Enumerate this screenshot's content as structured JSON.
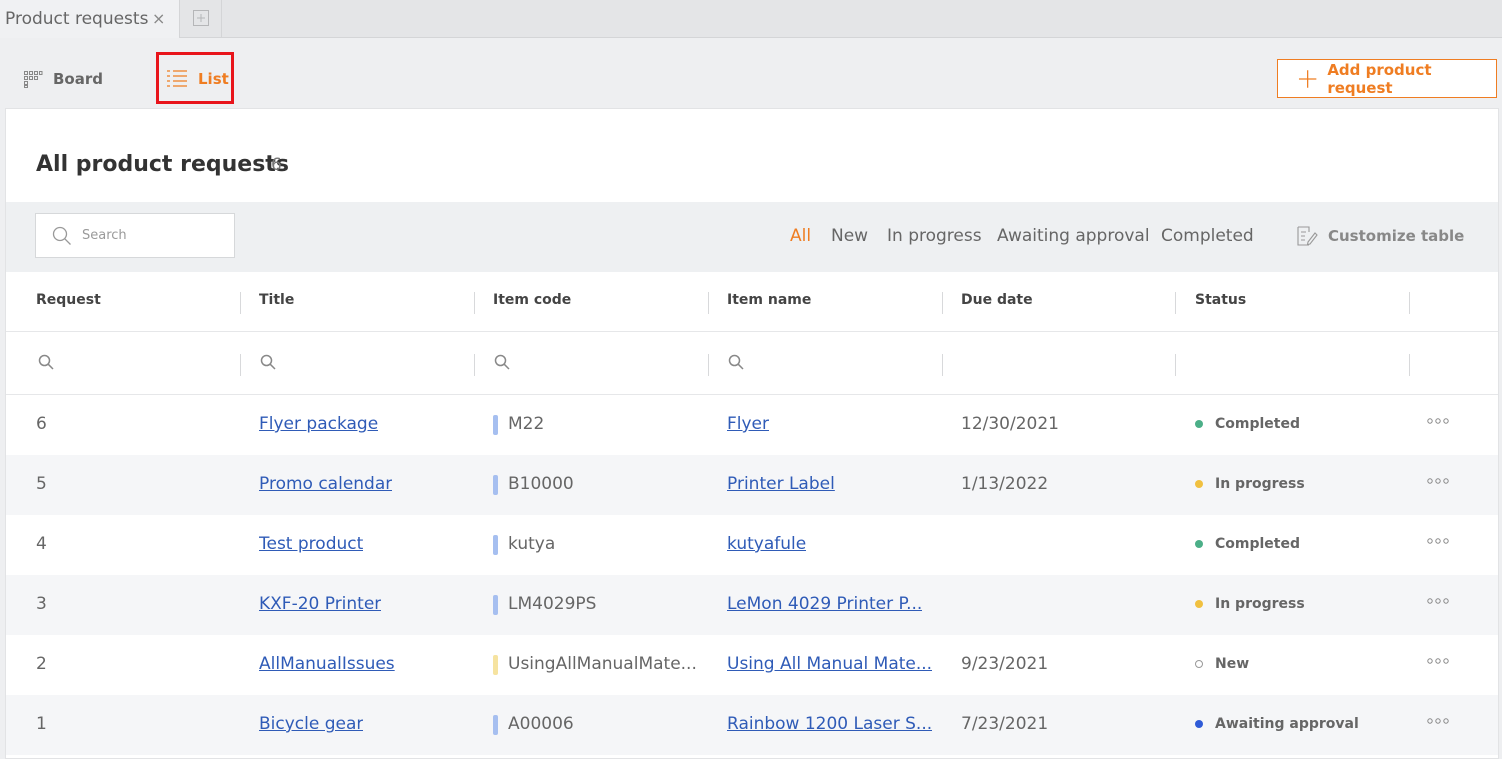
{
  "tab": {
    "title": "Product requests",
    "close": "×"
  },
  "views": {
    "board": "Board",
    "list": "List"
  },
  "add_button": "Add product request",
  "heading": {
    "title": "All product requests",
    "count": "6"
  },
  "search": {
    "placeholder": "Search"
  },
  "status_filters": [
    "All",
    "New",
    "In progress",
    "Awaiting approval",
    "Completed"
  ],
  "customize": "Customize table",
  "columns": [
    "Request",
    "Title",
    "Item code",
    "Item name",
    "Due date",
    "Status"
  ],
  "colors": {
    "accent": "#ef7d22",
    "link": "#2f5bb7",
    "completed": "#4caf88",
    "in_progress": "#f0c040",
    "new": "#ffffff",
    "awaiting": "#2f5bd7",
    "code_blue": "#a6bff0",
    "code_yellow": "#f6e3a0"
  },
  "rows": [
    {
      "request": "6",
      "title": "Flyer package",
      "item_code": "M22",
      "item_name": "Flyer",
      "due_date": "12/30/2021",
      "status": "Completed",
      "code_color": "blue"
    },
    {
      "request": "5",
      "title": "Promo calendar",
      "item_code": "B10000",
      "item_name": "Printer Label",
      "due_date": "1/13/2022",
      "status": "In progress",
      "code_color": "blue"
    },
    {
      "request": "4",
      "title": "Test product",
      "item_code": "kutya",
      "item_name": "kutyafule",
      "due_date": "",
      "status": "Completed",
      "code_color": "blue"
    },
    {
      "request": "3",
      "title": "KXF-20 Printer",
      "item_code": "LM4029PS",
      "item_name": "LeMon 4029 Printer P...",
      "due_date": "",
      "status": "In progress",
      "code_color": "blue"
    },
    {
      "request": "2",
      "title": "AllManualIssues",
      "item_code": "UsingAllManualMate...",
      "item_name": "Using All Manual Mate...",
      "due_date": "9/23/2021",
      "status": "New",
      "code_color": "yellow"
    },
    {
      "request": "1",
      "title": "Bicycle gear",
      "item_code": "A00006",
      "item_name": "Rainbow 1200 Laser S...",
      "due_date": "7/23/2021",
      "status": "Awaiting approval",
      "code_color": "blue"
    }
  ]
}
